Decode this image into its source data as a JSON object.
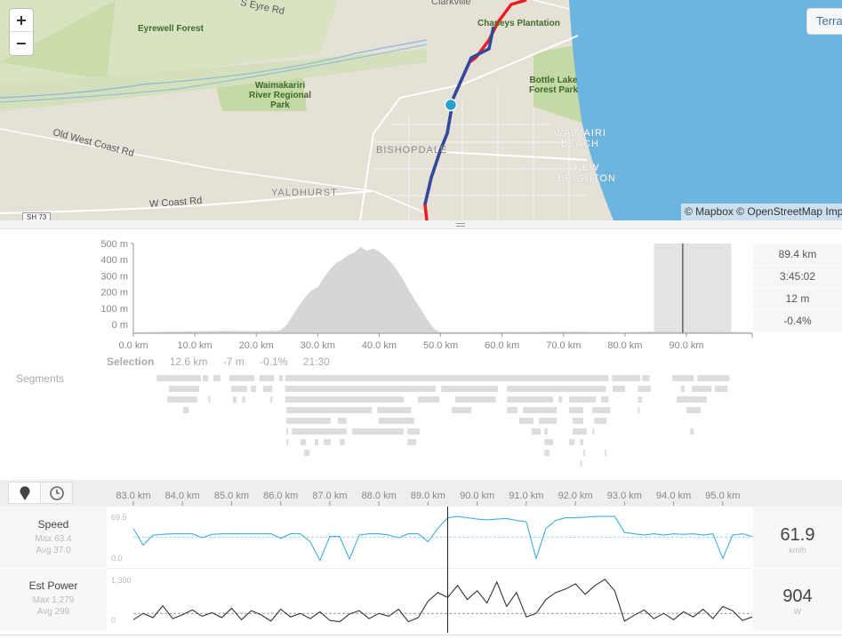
{
  "map": {
    "zoom_in": "+",
    "zoom_out": "−",
    "terrain_label": "Terrain",
    "attribution": "© Mapbox © OpenStreetMap Imp",
    "labels": {
      "eyre": "S Eyre Rd",
      "eyrewell": "Eyrewell Forest",
      "waimak": "Waimakariri River Regional Park",
      "oldwest": "Old West Coast Rd",
      "wcoast": "W Coast Rd",
      "yaldhurst": "YALDHURST",
      "bishopdale": "BISHOPDALE",
      "clarkville": "Clarkville",
      "chaneys": "Chaneys Plantation",
      "bottle": "Bottle Lake Forest Park",
      "waimairi": "WAIMAIRI BEACH",
      "brighton": "NEW BRIGHTON",
      "sh73": "SH 73"
    },
    "colors": {
      "land": "#e6e1d7",
      "park": "#c9dba8",
      "water": "#6bb5e0",
      "route": "#ee1c24",
      "selection": "#2b4ba0",
      "marker": "#2a9fd0"
    }
  },
  "elevation": {
    "chart_data": {
      "type": "area",
      "x_unit": "km",
      "y_unit": "m",
      "xlim": [
        0,
        100.7
      ],
      "ylim": [
        -55,
        500
      ],
      "xticks": [
        "0.0 km",
        "10.0 km",
        "20.0 km",
        "30.0 km",
        "40.0 km",
        "50.0 km",
        "60.0 km",
        "70.0 km",
        "80.0 km",
        "90.0 km"
      ],
      "yticks": [
        "500 m",
        "400 m",
        "300 m",
        "200 m",
        "100 m",
        "0 m"
      ],
      "x": [
        0,
        5,
        10,
        15,
        20,
        23,
        24,
        25,
        26,
        27,
        28,
        29,
        30,
        31,
        32,
        33,
        34,
        35,
        36,
        37,
        38,
        39,
        40,
        41,
        42,
        43,
        44,
        45,
        46,
        47,
        48,
        49,
        50,
        55,
        60,
        65,
        70,
        75,
        80,
        85,
        90,
        95,
        100.7
      ],
      "y": [
        -50,
        -45,
        -42,
        -40,
        -42,
        -40,
        -35,
        0,
        60,
        120,
        170,
        210,
        230,
        290,
        340,
        380,
        400,
        430,
        445,
        480,
        455,
        470,
        450,
        420,
        380,
        330,
        270,
        200,
        140,
        80,
        20,
        -30,
        -48,
        -48,
        -46,
        -47,
        -44,
        -46,
        -48,
        -44,
        -45,
        -46,
        -48
      ],
      "selection_km": [
        84.7,
        97.3
      ],
      "cursor_km": 89.4
    },
    "stats": [
      "89.4 km",
      "3:45:02",
      "12 m",
      "-0.4%"
    ],
    "selection": {
      "label": "Selection",
      "distance": "12.6 km",
      "elev": "-7 m",
      "grade": "-0.1%",
      "time": "21:30"
    }
  },
  "segments": {
    "label": "Segments",
    "color": "#dddddd",
    "rows_km": [
      [
        [
          3.8,
          11.0
        ],
        [
          11.3,
          12.2
        ],
        [
          13.0,
          14.2
        ],
        [
          15.6,
          19.7
        ],
        [
          20.5,
          22.9
        ],
        [
          23.7,
          24.3
        ],
        [
          24.7,
          77.3
        ],
        [
          77.9,
          82.5
        ],
        [
          82.8,
          84.0
        ],
        [
          87.7,
          91.2
        ],
        [
          91.8,
          97.0
        ]
      ],
      [
        [
          5.8,
          10.7
        ],
        [
          15.9,
          18.5
        ],
        [
          19.1,
          20.0
        ],
        [
          21.1,
          22.6
        ],
        [
          24.7,
          49.2
        ],
        [
          50.1,
          59.3
        ],
        [
          60.8,
          76.9
        ],
        [
          78.0,
          80.0
        ],
        [
          82.1,
          84.2
        ],
        [
          89.1,
          89.7
        ],
        [
          90.9,
          94.1
        ],
        [
          94.6,
          96.7
        ]
      ],
      [
        [
          5.5,
          10.4
        ],
        [
          12.2,
          12.4
        ],
        [
          16.2,
          16.8
        ],
        [
          17.7,
          18.2
        ],
        [
          22.3,
          22.6
        ],
        [
          24.7,
          44.0
        ],
        [
          46.3,
          49.8
        ],
        [
          52.4,
          59.0
        ],
        [
          60.8,
          68.3
        ],
        [
          69.2,
          69.8
        ],
        [
          70.9,
          75.3
        ],
        [
          76.1,
          77.3
        ],
        [
          82.1,
          82.8
        ],
        [
          88.4,
          93.3
        ]
      ],
      [
        [
          8.1,
          9.0
        ],
        [
          24.9,
          38.8
        ],
        [
          39.7,
          45.2
        ],
        [
          51.8,
          55.0
        ],
        [
          60.8,
          62.5
        ],
        [
          63.4,
          68.9
        ],
        [
          70.9,
          73.2
        ],
        [
          74.7,
          77.6
        ],
        [
          82.1,
          82.4
        ],
        [
          90.0,
          92.3
        ]
      ],
      [
        [
          24.9,
          32.1
        ],
        [
          33.3,
          34.7
        ],
        [
          39.9,
          45.7
        ],
        [
          62.8,
          65.1
        ],
        [
          66.0,
          68.9
        ],
        [
          71.5,
          73.2
        ],
        [
          75.0,
          77.0
        ]
      ],
      [
        [
          24.9,
          25.2
        ],
        [
          25.8,
          34.7
        ],
        [
          35.6,
          44.0
        ],
        [
          44.6,
          46.6
        ],
        [
          64.8,
          66.3
        ],
        [
          66.9,
          67.4
        ],
        [
          71.5,
          73.8
        ],
        [
          74.7,
          75.0
        ],
        [
          90.6,
          91.2
        ]
      ],
      [
        [
          24.9,
          25.2
        ],
        [
          27.2,
          28.1
        ],
        [
          29.5,
          30.1
        ],
        [
          31.0,
          32.1
        ],
        [
          33.6,
          34.4
        ],
        [
          44.6,
          46.0
        ],
        [
          66.9,
          68.3
        ],
        [
          70.9,
          71.8
        ],
        [
          72.7,
          73.2
        ]
      ],
      [
        [
          27.8,
          28.7
        ],
        [
          66.9,
          67.7
        ],
        [
          73.2,
          73.5
        ],
        [
          76.7,
          77.0
        ]
      ],
      [
        [
          72.7,
          73.0
        ]
      ]
    ]
  },
  "streams": {
    "tabs": [
      {
        "icon": "map-pin-icon"
      },
      {
        "icon": "clock-icon"
      }
    ],
    "xlim": [
      83.0,
      95.6
    ],
    "xticks": [
      "83.0 km",
      "84.0 km",
      "85.0 km",
      "86.0 km",
      "87.0 km",
      "88.0 km",
      "89.0 km",
      "90.0 km",
      "91.0 km",
      "92.0 km",
      "93.0 km",
      "94.0 km",
      "95.0 km"
    ],
    "cursor_km": 89.4,
    "x": [
      83.0,
      83.2,
      83.4,
      83.6,
      83.8,
      84.0,
      84.2,
      84.4,
      84.6,
      84.8,
      85.0,
      85.2,
      85.4,
      85.6,
      85.8,
      86.0,
      86.2,
      86.4,
      86.6,
      86.8,
      87.0,
      87.2,
      87.4,
      87.6,
      87.8,
      88.0,
      88.2,
      88.4,
      88.6,
      88.8,
      89.0,
      89.2,
      89.4,
      89.6,
      89.8,
      90.0,
      90.2,
      90.4,
      90.6,
      90.8,
      91.0,
      91.2,
      91.4,
      91.6,
      91.8,
      92.0,
      92.2,
      92.4,
      92.6,
      92.8,
      93.0,
      93.2,
      93.4,
      93.6,
      93.8,
      94.0,
      94.2,
      94.4,
      94.6,
      94.8,
      95.0,
      95.2,
      95.4,
      95.6
    ],
    "speed": {
      "label": "Speed",
      "max": "Max 63.4",
      "avg": "Avg 37.0",
      "ymax_label": "69.5",
      "ymin_label": "0.0",
      "ylim": [
        0,
        69.5
      ],
      "avg_value": 37.0,
      "current": "61.9",
      "unit": "km/h",
      "color": "#3fb0de",
      "values": [
        50,
        25,
        40,
        41,
        42,
        42,
        42,
        36,
        41,
        42,
        42,
        42,
        42,
        42,
        42,
        35,
        42,
        42,
        30,
        2,
        38,
        38,
        4,
        40,
        42,
        42,
        40,
        36,
        42,
        42,
        30,
        50,
        66,
        68,
        66,
        64,
        63,
        64,
        65,
        62,
        60,
        5,
        50,
        62,
        66,
        66,
        67,
        68,
        68,
        68,
        44,
        42,
        40,
        42,
        40,
        42,
        41,
        42,
        40,
        42,
        5,
        40,
        42,
        38
      ]
    },
    "power": {
      "label": "Est Power",
      "max": "Max 1,279",
      "avg": "Avg 299",
      "ymax_label": "1,300",
      "ymin_label": "0",
      "ylim": [
        0,
        1300
      ],
      "avg_value": 299,
      "current": "904",
      "unit": "W",
      "color": "#333333",
      "values": [
        120,
        300,
        180,
        520,
        150,
        260,
        400,
        220,
        320,
        180,
        450,
        120,
        380,
        260,
        80,
        420,
        200,
        300,
        150,
        350,
        100,
        60,
        280,
        380,
        150,
        300,
        220,
        420,
        60,
        180,
        650,
        900,
        760,
        1100,
        700,
        950,
        600,
        1200,
        500,
        900,
        200,
        300,
        700,
        900,
        1000,
        1150,
        850,
        1100,
        1279,
        950,
        80,
        250,
        400,
        150,
        300,
        120,
        350,
        200,
        420,
        150,
        500,
        380,
        100,
        200
      ]
    }
  }
}
